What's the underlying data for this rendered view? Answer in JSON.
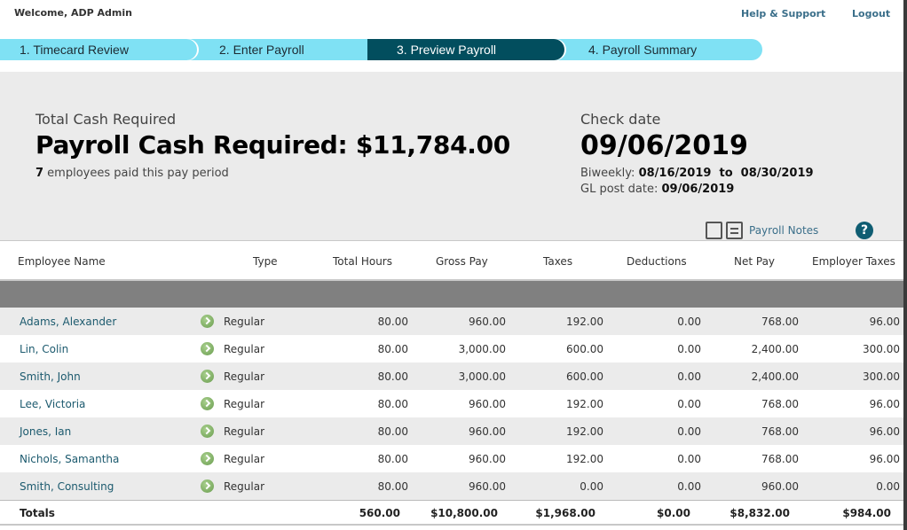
{
  "header": {
    "welcome": "Welcome, ADP Admin",
    "help_link": "Help & Support",
    "logout_link": "Logout"
  },
  "steps": [
    {
      "label": "1.  Timecard Review",
      "state": "inactive"
    },
    {
      "label": "2.  Enter Payroll",
      "state": "inactive"
    },
    {
      "label": "3.  Preview Payroll",
      "state": "active"
    },
    {
      "label": "4.  Payroll Summary",
      "state": "inactive"
    }
  ],
  "summary": {
    "total_label": "Total Cash Required",
    "amount_title": "Payroll Cash Required: $11,784.00",
    "employee_count": "7",
    "employee_suffix": " employees paid this pay period",
    "check_label": "Check date",
    "check_date": "09/06/2019",
    "period_prefix": "Biweekly: ",
    "period_value": "08/16/2019  to  08/30/2019",
    "gl_prefix": "GL post date: ",
    "gl_value": "09/06/2019",
    "notes_link": "Payroll Notes",
    "help_icon": "?"
  },
  "table": {
    "columns": [
      "Employee Name",
      "Type",
      "Total Hours",
      "Gross Pay",
      "Taxes",
      "Deductions",
      "Net Pay",
      "Employer Taxes"
    ],
    "rows": [
      {
        "name": "Adams, Alexander",
        "type": "Regular",
        "hours": "80.00",
        "gross": "960.00",
        "taxes": "192.00",
        "deductions": "0.00",
        "net": "768.00",
        "employer": "96.00"
      },
      {
        "name": "Lin, Colin",
        "type": "Regular",
        "hours": "80.00",
        "gross": "3,000.00",
        "taxes": "600.00",
        "deductions": "0.00",
        "net": "2,400.00",
        "employer": "300.00"
      },
      {
        "name": "Smith, John",
        "type": "Regular",
        "hours": "80.00",
        "gross": "3,000.00",
        "taxes": "600.00",
        "deductions": "0.00",
        "net": "2,400.00",
        "employer": "300.00"
      },
      {
        "name": "Lee, Victoria",
        "type": "Regular",
        "hours": "80.00",
        "gross": "960.00",
        "taxes": "192.00",
        "deductions": "0.00",
        "net": "768.00",
        "employer": "96.00"
      },
      {
        "name": "Jones, Ian",
        "type": "Regular",
        "hours": "80.00",
        "gross": "960.00",
        "taxes": "192.00",
        "deductions": "0.00",
        "net": "768.00",
        "employer": "96.00"
      },
      {
        "name": "Nichols, Samantha",
        "type": "Regular",
        "hours": "80.00",
        "gross": "960.00",
        "taxes": "192.00",
        "deductions": "0.00",
        "net": "768.00",
        "employer": "96.00"
      },
      {
        "name": "Smith, Consulting",
        "type": "Regular",
        "hours": "80.00",
        "gross": "960.00",
        "taxes": "0.00",
        "deductions": "0.00",
        "net": "960.00",
        "employer": "0.00"
      }
    ],
    "totals": {
      "label": "Totals",
      "hours": "560.00",
      "gross": "$10,800.00",
      "taxes": "$1,968.00",
      "deductions": "$0.00",
      "net": "$8,832.00",
      "employer": "$984.00"
    }
  },
  "colors": {
    "step_inactive": "#7fe1f4",
    "step_active": "#024e5e",
    "link": "#3b6f8a",
    "help_icon": "#0f5d72",
    "filter_bar": "#808080",
    "row_alt": "#ebebeb"
  }
}
